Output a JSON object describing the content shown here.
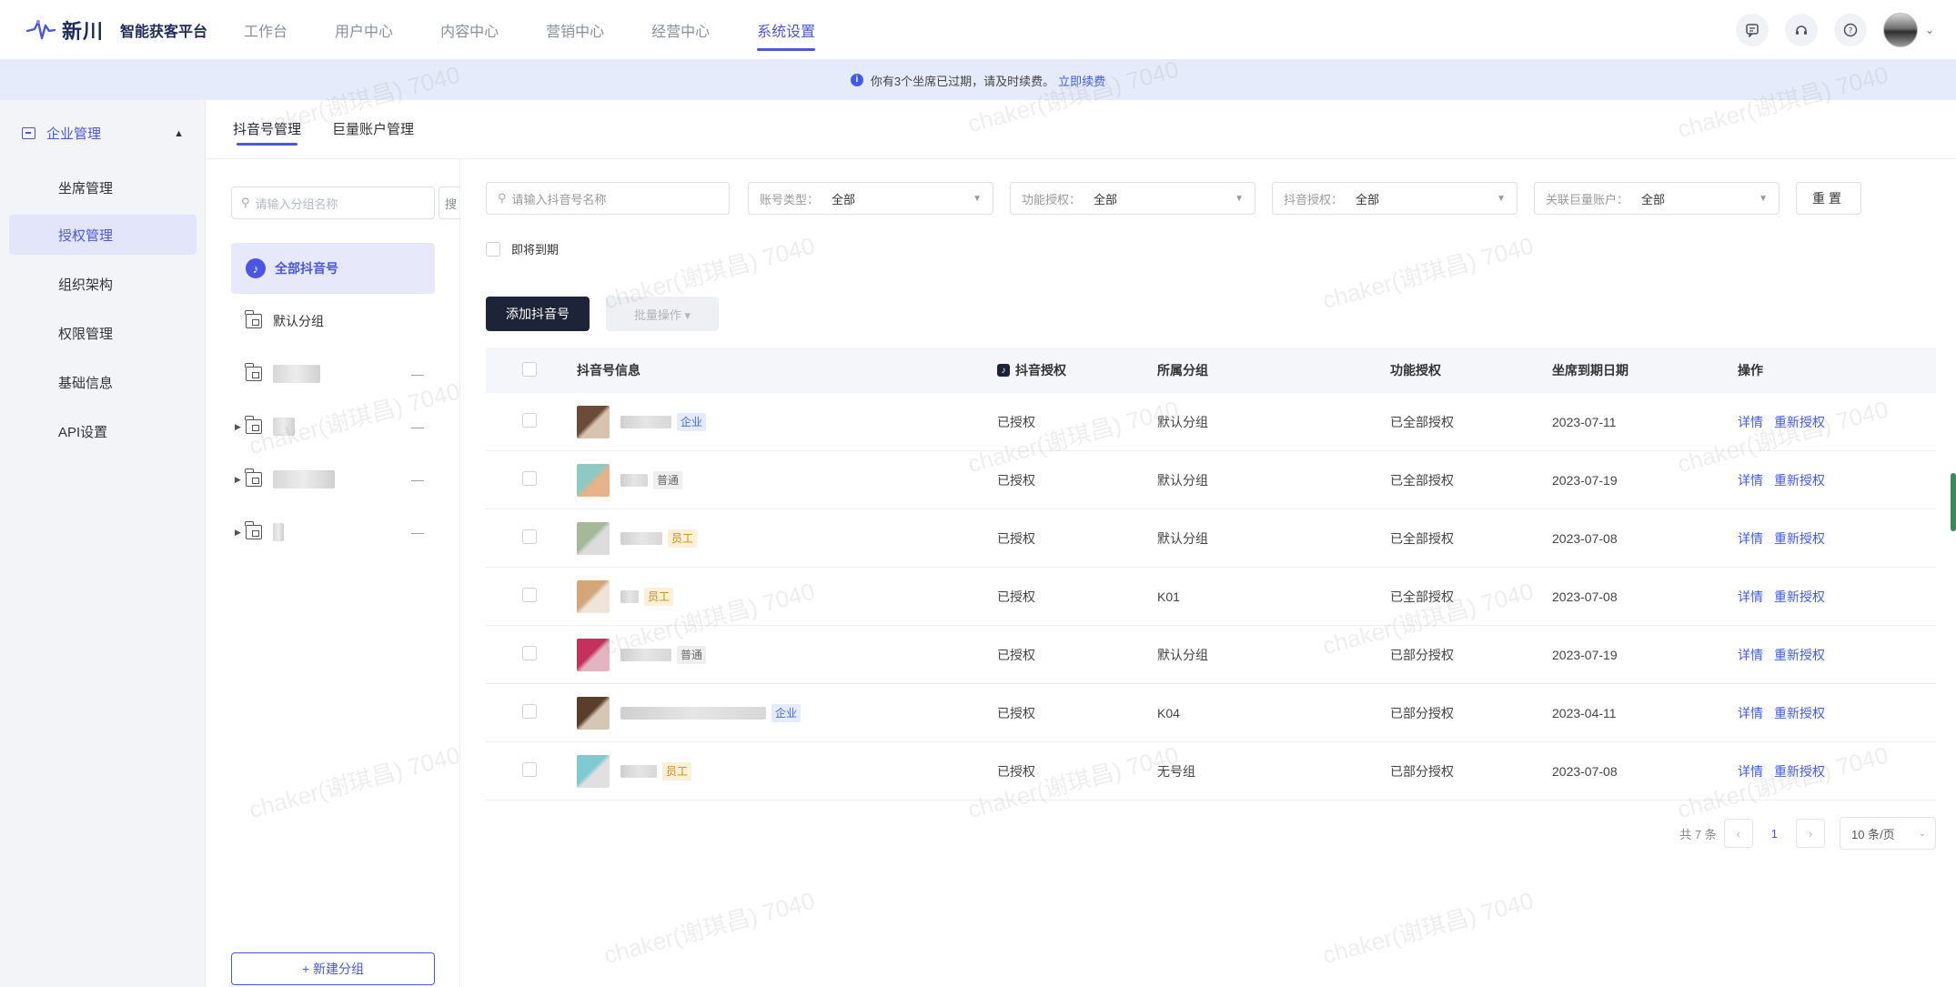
{
  "brand": {
    "name": "新川",
    "subtitle": "智能获客平台"
  },
  "nav": {
    "items": [
      {
        "label": "工作台"
      },
      {
        "label": "用户中心"
      },
      {
        "label": "内容中心"
      },
      {
        "label": "营销中心"
      },
      {
        "label": "经营中心"
      },
      {
        "label": "系统设置"
      }
    ],
    "active": "系统设置"
  },
  "notice": {
    "text": "你有3个坐席已过期，请及时续费。",
    "link": "立即续费"
  },
  "sidebar": {
    "group_label": "企业管理",
    "items": [
      {
        "label": "坐席管理"
      },
      {
        "label": "授权管理"
      },
      {
        "label": "组织架构"
      },
      {
        "label": "权限管理"
      },
      {
        "label": "基础信息"
      },
      {
        "label": "API设置"
      }
    ],
    "active": "授权管理"
  },
  "subtabs": {
    "items": [
      {
        "label": "抖音号管理"
      },
      {
        "label": "巨量账户管理"
      }
    ],
    "active": "抖音号管理"
  },
  "groups": {
    "search_placeholder": "请输入分组名称",
    "search_tail": "搜",
    "all_label": "全部抖音号",
    "default_label": "默认分组",
    "new_group_label": "+ 新建分组",
    "more_symbol": "—"
  },
  "filters": {
    "account_search_placeholder": "请输入抖音号名称",
    "account_type": {
      "label": "账号类型：",
      "value": "全部"
    },
    "func_auth": {
      "label": "功能授权：",
      "value": "全部"
    },
    "douyin_auth": {
      "label": "抖音授权：",
      "value": "全部"
    },
    "linked_account": {
      "label": "关联巨量账户：",
      "value": "全部"
    },
    "reset_label": "重置",
    "expiring_label": "即将到期"
  },
  "actions": {
    "add_label": "添加抖音号",
    "batch_label": "批量操作 ▾"
  },
  "table": {
    "headers": {
      "info": "抖音号信息",
      "auth": "抖音授权",
      "group": "所属分组",
      "func": "功能授权",
      "date": "坐席到期日期",
      "ops": "操作"
    },
    "rows": [
      {
        "tag": "企业",
        "tag_type": "blue",
        "auth": "已授权",
        "group": "默认分组",
        "func": "已全部授权",
        "date": "2023-07-11",
        "colors": [
          "#6b4b3a",
          "#d8c2b0"
        ]
      },
      {
        "tag": "普通",
        "tag_type": "gray",
        "auth": "已授权",
        "group": "默认分组",
        "func": "已全部授权",
        "date": "2023-07-19",
        "colors": [
          "#8fc9c4",
          "#e8b28a"
        ]
      },
      {
        "tag": "员工",
        "tag_type": "orange",
        "auth": "已授权",
        "group": "默认分组",
        "func": "已全部授权",
        "date": "2023-07-08",
        "colors": [
          "#a3b99a",
          "#dcdcdc"
        ]
      },
      {
        "tag": "员工",
        "tag_type": "orange",
        "auth": "已授权",
        "group": "K01",
        "func": "已全部授权",
        "date": "2023-07-08",
        "colors": [
          "#d4a679",
          "#efe4da"
        ]
      },
      {
        "tag": "普通",
        "tag_type": "gray",
        "auth": "已授权",
        "group": "默认分组",
        "func": "已部分授权",
        "date": "2023-07-19",
        "colors": [
          "#c2325c",
          "#e2b5c1"
        ]
      },
      {
        "tag": "企业",
        "tag_type": "blue",
        "auth": "已授权",
        "group": "K04",
        "func": "已部分授权",
        "date": "2023-04-11",
        "colors": [
          "#5a3e2b",
          "#d6c6b5"
        ]
      },
      {
        "tag": "员工",
        "tag_type": "orange",
        "auth": "已授权",
        "group": "无号组",
        "func": "已部分授权",
        "date": "2023-07-08",
        "colors": [
          "#7fcad1",
          "#e0e0e0"
        ]
      }
    ],
    "op_detail": "详情",
    "op_reauth": "重新授权"
  },
  "pagination": {
    "total_text": "共 7 条",
    "current_page": "1",
    "page_size": "10 条/页"
  },
  "watermark": "chaker(谢琪昌) 7040",
  "colors": {
    "primary": "#4a56e2",
    "dark_button": "#1d2437",
    "notice_bg": "#e6ebfb",
    "link": "#3f5bef"
  }
}
